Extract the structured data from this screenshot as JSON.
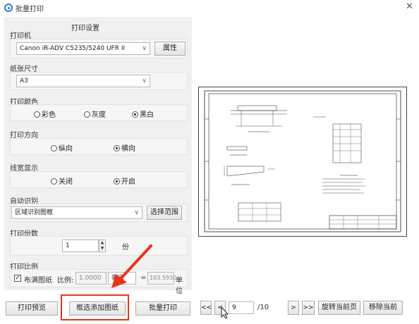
{
  "window": {
    "title": "批量打印",
    "close_icon": "close-icon"
  },
  "panel": {
    "title": "打印设置"
  },
  "printer": {
    "label": "打印机",
    "selected": "Canon iR-ADV C5235/5240 UFR II",
    "properties_button": "属性"
  },
  "paper": {
    "label": "纸张尺寸",
    "selected": "A3"
  },
  "color": {
    "label": "打印颜色",
    "options": [
      "彩色",
      "灰度",
      "黑白"
    ],
    "selected": "黑白"
  },
  "orientation": {
    "label": "打印方向",
    "options": [
      "纵向",
      "横向"
    ],
    "selected": "横向"
  },
  "lineweight": {
    "label": "线宽显示",
    "options": [
      "关闭",
      "开启"
    ],
    "selected": "开启"
  },
  "auto_detect": {
    "label": "自动识别",
    "selected": "区域识别图框",
    "range_button": "选择范围"
  },
  "copies": {
    "label": "打印份数",
    "value": "1",
    "unit": "份"
  },
  "scale": {
    "label": "打印比例",
    "fill_label": "布满图纸",
    "fill_checked": true,
    "ratio_label": "比例:",
    "ratio_value": "1.0000",
    "unit_selected": "毫米",
    "equals": "=",
    "result_value": "103.5930",
    "unit_label": "单位"
  },
  "buttons": {
    "preview": "打印预览",
    "add_by_frame": "框选添加图纸",
    "batch_print": "批量打印"
  },
  "pager": {
    "first": "<<",
    "prev": "<",
    "current": "9",
    "total": "/10",
    "next": ">",
    "last": ">>",
    "rotate_current": "旋转当前页",
    "remove_current": "移除当前"
  },
  "colors": {
    "accent": "#2a7de1",
    "highlight": "#e8341c"
  }
}
